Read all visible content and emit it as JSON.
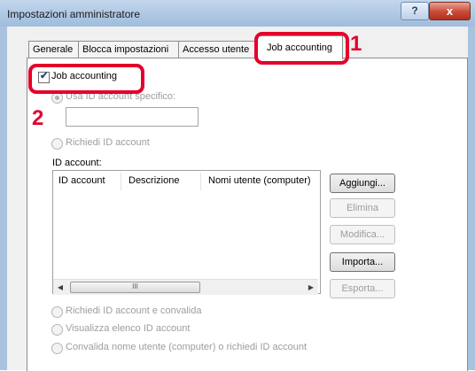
{
  "window": {
    "title": "Impostazioni amministratore",
    "help_label": "?",
    "close_label": "x"
  },
  "tabs": [
    {
      "label": "Generale"
    },
    {
      "label": "Blocca impostazioni"
    },
    {
      "label": "Accesso utente"
    },
    {
      "label": "Job accounting",
      "active": true
    }
  ],
  "callouts": {
    "one": "1",
    "two": "2"
  },
  "job_accounting": {
    "label": "Job accounting",
    "checked": true
  },
  "options": {
    "specific_id": "Usa ID account specifico:",
    "specific_id_value": "",
    "request_id": "Richiedi ID account",
    "request_validate": "Richiedi ID account e convalida",
    "show_list": "Visualizza elenco ID account",
    "validate_username": "Convalida nome utente (computer) o richiedi ID account"
  },
  "account_list": {
    "label": "ID account:",
    "columns": [
      "ID account",
      "Descrizione",
      "Nomi utente (computer)"
    ],
    "rows": [],
    "scroll_thumb_glyph": "III"
  },
  "buttons": {
    "add": "Aggiungi...",
    "delete": "Elimina",
    "edit": "Modifica...",
    "import": "Importa...",
    "export": "Esporta..."
  },
  "colors": {
    "callout": "#e4002b",
    "titlebar": "#b4cbe6",
    "close_button": "#c94a35"
  }
}
